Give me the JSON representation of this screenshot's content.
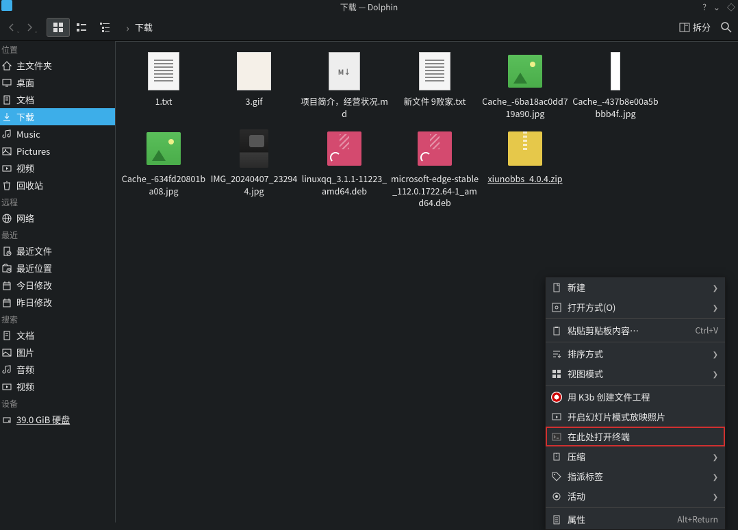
{
  "title": "下载 — Dolphin",
  "breadcrumb": "下载",
  "split_label": "拆分",
  "sidebar": {
    "sections": [
      {
        "header": "位置",
        "items": [
          {
            "icon": "home",
            "label": "主文件夹"
          },
          {
            "icon": "desktop",
            "label": "桌面"
          },
          {
            "icon": "docs",
            "label": "文档"
          },
          {
            "icon": "download",
            "label": "下载",
            "active": true
          },
          {
            "icon": "music",
            "label": "Music"
          },
          {
            "icon": "pictures",
            "label": "Pictures"
          },
          {
            "icon": "video",
            "label": "视频"
          },
          {
            "icon": "trash",
            "label": "回收站"
          }
        ]
      },
      {
        "header": "远程",
        "items": [
          {
            "icon": "network",
            "label": "网络"
          }
        ]
      },
      {
        "header": "最近",
        "items": [
          {
            "icon": "recent-files",
            "label": "最近文件"
          },
          {
            "icon": "recent-loc",
            "label": "最近位置"
          },
          {
            "icon": "today",
            "label": "今日修改"
          },
          {
            "icon": "yesterday",
            "label": "昨日修改"
          }
        ]
      },
      {
        "header": "搜索",
        "items": [
          {
            "icon": "docs",
            "label": "文档"
          },
          {
            "icon": "image",
            "label": "图片"
          },
          {
            "icon": "audio",
            "label": "音频"
          },
          {
            "icon": "video",
            "label": "视频"
          }
        ]
      },
      {
        "header": "设备",
        "items": [
          {
            "icon": "disk",
            "label": "39.0 GiB 硬盘",
            "underlined": true
          }
        ]
      }
    ]
  },
  "files": [
    {
      "type": "text",
      "label": "1.txt"
    },
    {
      "type": "gif",
      "label": "3.gif"
    },
    {
      "type": "md",
      "label": "项目简介，经营状况.md"
    },
    {
      "type": "text",
      "label": "新文件 9败家.txt"
    },
    {
      "type": "landscape",
      "label": "Cache_-6ba18ac0dd719a90.jpg"
    },
    {
      "type": "portrait",
      "label": "Cache_-437b8e00a5bbbb4f..jpg"
    },
    {
      "type": "landscape",
      "label": "Cache_-634fd20801ba08.jpg"
    },
    {
      "type": "photo",
      "label": "IMG_20240407_232944.jpg"
    },
    {
      "type": "deb",
      "label": "linuxqq_3.1.1-11223_amd64.deb"
    },
    {
      "type": "deb",
      "label": "microsoft-edge-stable_112.0.1722.64-1_amd64.deb"
    },
    {
      "type": "zip",
      "label": "xiunobbs_4.0.4.zip",
      "underlined": true
    }
  ],
  "menu": [
    {
      "icon": "new",
      "label": "新建",
      "arrow": true
    },
    {
      "icon": "open",
      "label": "打开方式(O)",
      "arrow": true
    },
    {
      "sep": true
    },
    {
      "icon": "paste",
      "label": "粘贴剪贴板内容…",
      "shortcut": "Ctrl+V"
    },
    {
      "sep": true
    },
    {
      "icon": "sort",
      "label": "排序方式",
      "arrow": true
    },
    {
      "icon": "viewmode",
      "label": "视图模式",
      "arrow": true
    },
    {
      "sep": true
    },
    {
      "icon": "k3b",
      "label": "用 K3b 创建文件工程"
    },
    {
      "icon": "slideshow",
      "label": "开启幻灯片模式放映照片"
    },
    {
      "icon": "terminal",
      "label": "在此处打开终端",
      "highlighted": true
    },
    {
      "icon": "compress",
      "label": "压缩",
      "arrow": true
    },
    {
      "icon": "tag",
      "label": "指派标签",
      "arrow": true
    },
    {
      "icon": "activity",
      "label": "活动",
      "arrow": true
    },
    {
      "sep": true
    },
    {
      "icon": "props",
      "label": "属性",
      "shortcut": "Alt+Return"
    }
  ]
}
